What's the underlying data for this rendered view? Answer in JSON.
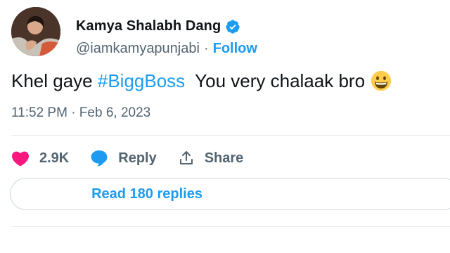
{
  "user": {
    "display_name": "Kamya Shalabh Dang",
    "handle": "@iamkamyapunjabi",
    "separator": "·",
    "follow_label": "Follow",
    "verified_color": "#1d9bf0"
  },
  "tweet": {
    "text_before": "Khel gaye ",
    "hashtag": "#BiggBoss",
    "text_after": "  You very chalaak bro",
    "emoji": "grinning-face",
    "timestamp": "11:52 PM · Feb 6, 2023"
  },
  "actions": {
    "like_count": "2.9K",
    "reply_label": "Reply",
    "share_label": "Share"
  },
  "replies_button": {
    "label": "Read 180 replies"
  },
  "colors": {
    "accent": "#1d9bf0",
    "like": "#f91880",
    "muted": "#536471",
    "text": "#0f1419"
  }
}
